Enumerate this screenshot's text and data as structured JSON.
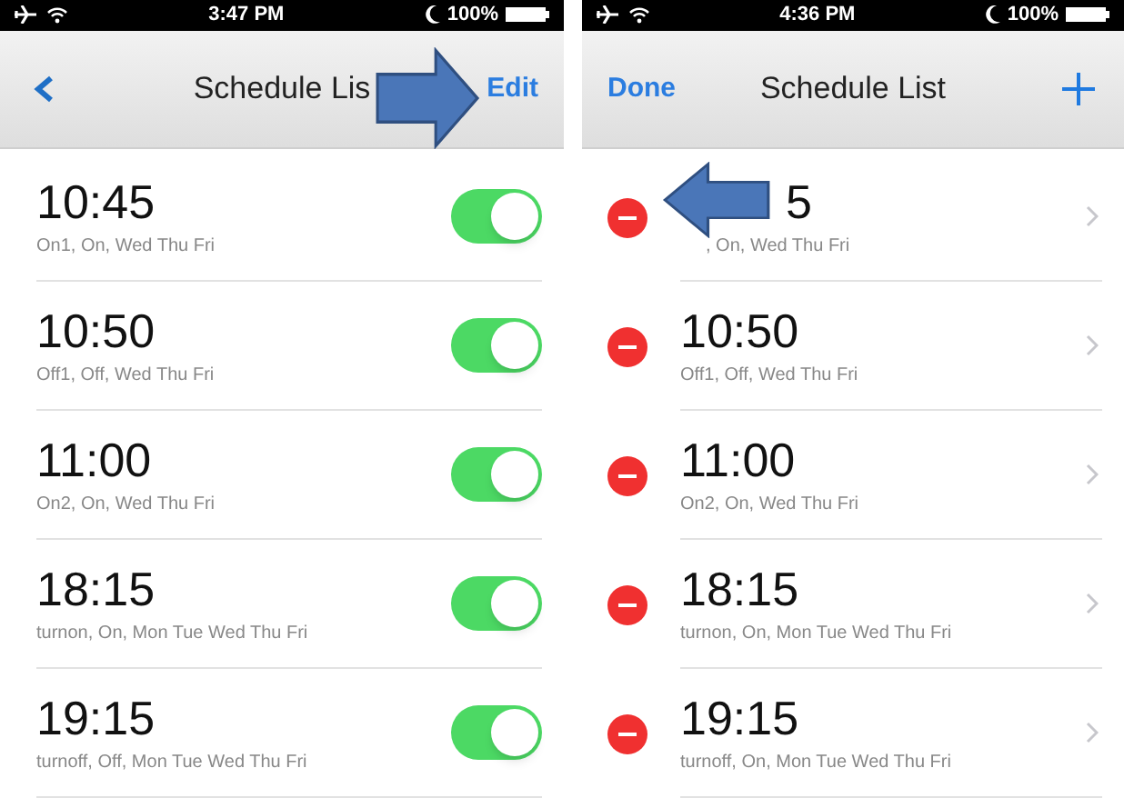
{
  "screens": [
    {
      "status_bar": {
        "time": "3:47 PM",
        "battery": "100%"
      },
      "nav": {
        "left": {
          "kind": "back"
        },
        "title": "Schedule Lis",
        "right": {
          "kind": "text",
          "label": "Edit"
        }
      },
      "callout": {
        "kind": "right_arrow"
      },
      "rows": [
        {
          "kind": "toggle",
          "time": "10:45",
          "detail": "On1, On, Wed Thu Fri",
          "on": true
        },
        {
          "kind": "toggle",
          "time": "10:50",
          "detail": "Off1, Off, Wed Thu Fri",
          "on": true
        },
        {
          "kind": "toggle",
          "time": "11:00",
          "detail": "On2, On, Wed Thu Fri",
          "on": true
        },
        {
          "kind": "toggle",
          "time": "18:15",
          "detail": "turnon, On, Mon Tue Wed Thu Fri",
          "on": true
        },
        {
          "kind": "toggle",
          "time": "19:15",
          "detail": "turnoff, Off, Mon Tue Wed Thu Fri",
          "on": true
        }
      ]
    },
    {
      "status_bar": {
        "time": "4:36 PM",
        "battery": "100%"
      },
      "nav": {
        "left": {
          "kind": "text",
          "label": "Done"
        },
        "title": "Schedule List",
        "right": {
          "kind": "add"
        }
      },
      "callout": {
        "kind": "left_arrow"
      },
      "rows": [
        {
          "kind": "edit_covered",
          "time": "5",
          "detail": ", On, Wed Thu Fri"
        },
        {
          "kind": "edit",
          "time": "10:50",
          "detail": "Off1, Off, Wed Thu Fri"
        },
        {
          "kind": "edit",
          "time": "11:00",
          "detail": "On2, On, Wed Thu Fri"
        },
        {
          "kind": "edit",
          "time": "18:15",
          "detail": "turnon, On, Mon Tue Wed Thu Fri"
        },
        {
          "kind": "edit",
          "time": "19:15",
          "detail": "turnoff, On, Mon Tue Wed Thu Fri"
        }
      ]
    }
  ]
}
